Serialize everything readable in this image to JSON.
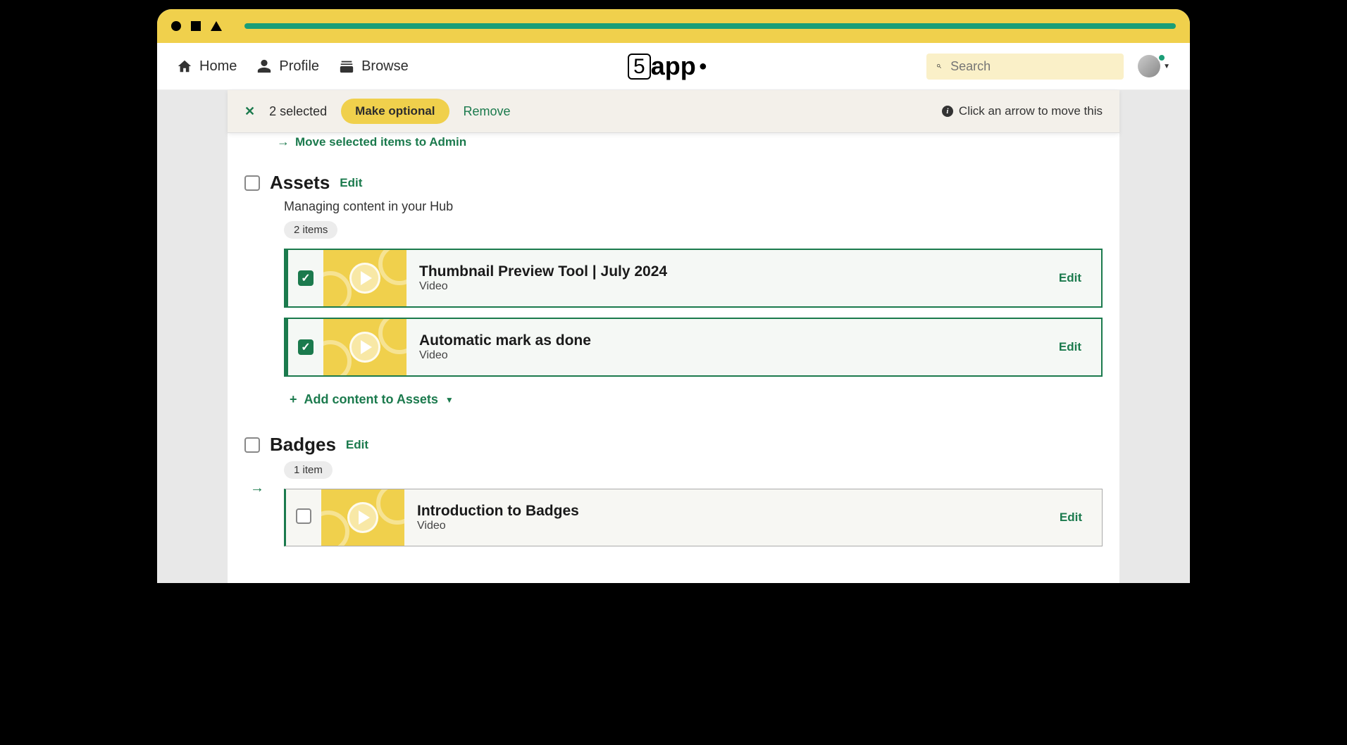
{
  "nav": {
    "home": "Home",
    "profile": "Profile",
    "browse": "Browse"
  },
  "logo": {
    "text": "5app"
  },
  "search": {
    "placeholder": "Search"
  },
  "actionBar": {
    "selectedText": "2 selected",
    "makeOptional": "Make optional",
    "remove": "Remove",
    "hint": "Click an arrow to move this"
  },
  "moveHint": "Move selected items to Admin",
  "sections": [
    {
      "title": "Assets",
      "edit": "Edit",
      "description": "Managing content in your Hub",
      "count": "2 items",
      "addLabel": "Add content to Assets",
      "items": [
        {
          "title": "Thumbnail Preview Tool | July 2024",
          "type": "Video",
          "checked": true,
          "edit": "Edit"
        },
        {
          "title": "Automatic mark as done",
          "type": "Video",
          "checked": true,
          "edit": "Edit"
        }
      ]
    },
    {
      "title": "Badges",
      "edit": "Edit",
      "count": "1 item",
      "items": [
        {
          "title": "Introduction to Badges",
          "type": "Video",
          "checked": false,
          "edit": "Edit"
        }
      ]
    }
  ]
}
